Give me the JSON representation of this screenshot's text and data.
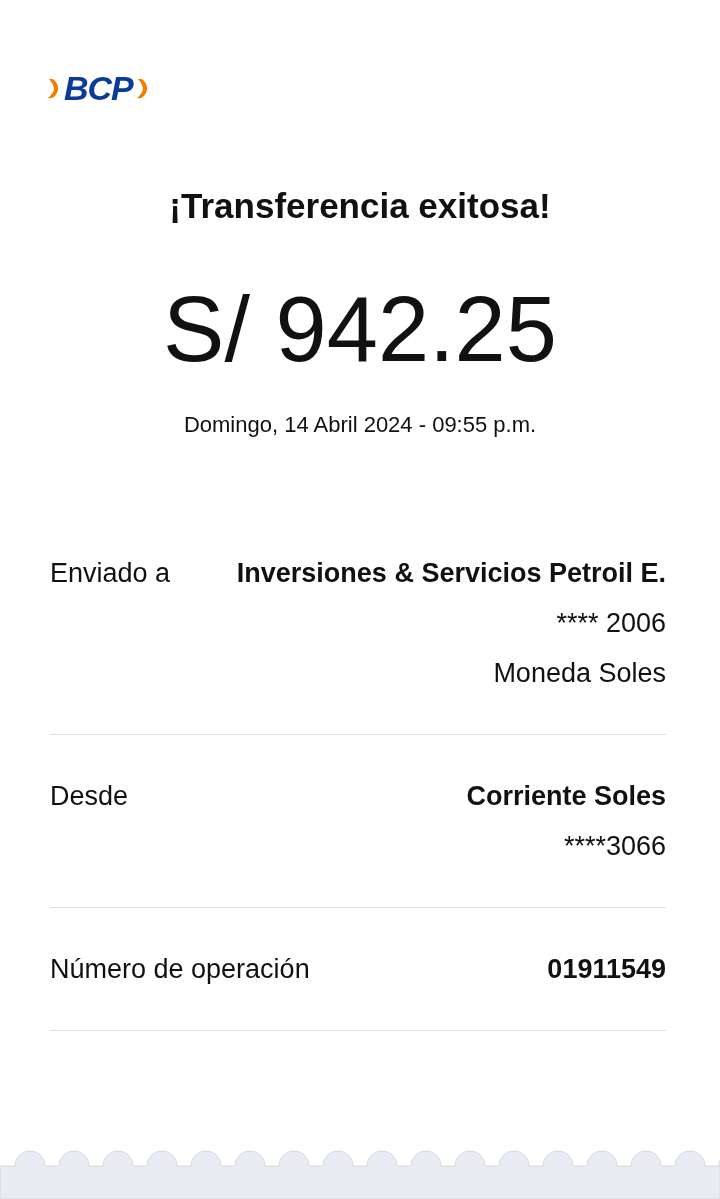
{
  "logo": {
    "text": "BCP"
  },
  "title": "¡Transferencia exitosa!",
  "amount": "S/ 942.25",
  "datetime": "Domingo, 14 Abril 2024 - 09:55 p.m.",
  "details": [
    {
      "label": "Enviado a",
      "lines": [
        {
          "text": "Inversiones & Servicios Petroil E.",
          "strong": true
        },
        {
          "text": "**** 2006",
          "strong": false
        },
        {
          "text": "Moneda Soles",
          "strong": false
        }
      ]
    },
    {
      "label": "Desde",
      "lines": [
        {
          "text": "Corriente Soles",
          "strong": true
        },
        {
          "text": "****3066",
          "strong": false
        }
      ]
    },
    {
      "label": "Número de operación",
      "lines": [
        {
          "text": "01911549",
          "strong": true
        }
      ]
    }
  ]
}
